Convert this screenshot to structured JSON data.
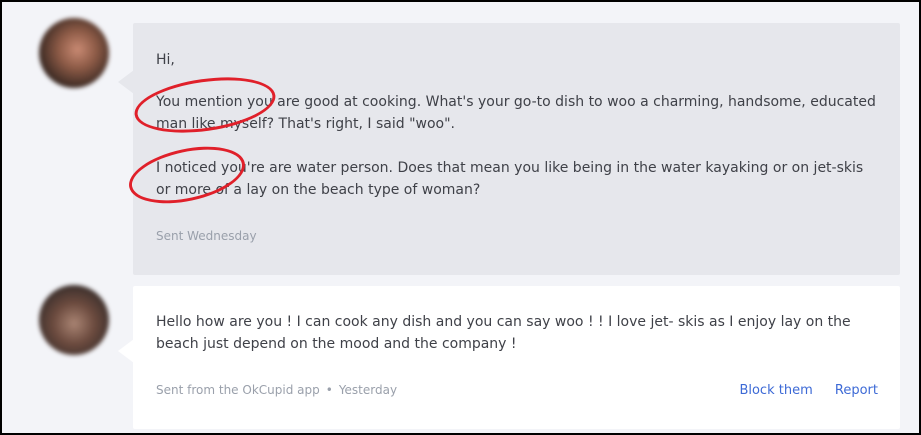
{
  "conversation": {
    "messages": [
      {
        "greeting": "Hi,",
        "paragraph1": "You mention you are good at cooking. What's your go-to dish to woo a charming, handsome, educated man like myself? That's right, I said \"woo\".",
        "paragraph2": "I noticed you're are water person. Does that mean you like being in the water kayaking or on jet-skis or more of a lay on the beach type of woman?",
        "meta": "Sent Wednesday"
      },
      {
        "paragraph1": "Hello how are you ! I can cook any dish and you can say woo ! ! I love jet- skis as I enjoy lay on the beach just depend on the mood and the company !",
        "meta_source": "Sent from the OkCupid app",
        "meta_separator": "•",
        "meta_time": "Yesterday",
        "actions": {
          "block": "Block them",
          "report": "Report"
        }
      }
    ]
  },
  "colors": {
    "sent_bubble": "#e6e7ec",
    "received_bubble": "#ffffff",
    "background": "#f3f4f8",
    "link": "#3d6ad6",
    "annotation": "#e0202a"
  }
}
